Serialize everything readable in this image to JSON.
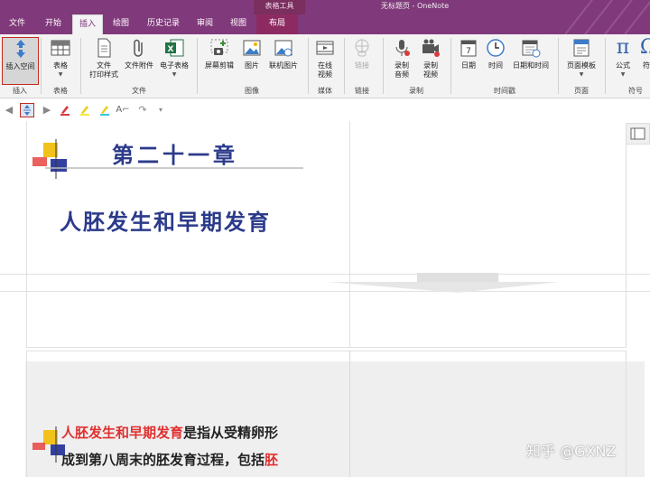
{
  "title_bar": {
    "contextual_label": "表格工具",
    "window_title": "无标题页 - OneNote"
  },
  "tabs": [
    {
      "label": "文件"
    },
    {
      "label": "开始"
    },
    {
      "label": "插入"
    },
    {
      "label": "绘图"
    },
    {
      "label": "历史记录"
    },
    {
      "label": "审阅"
    },
    {
      "label": "视图"
    },
    {
      "label": "布局"
    }
  ],
  "ribbon": {
    "insert_space": "插入空间",
    "table": "表格",
    "file_printout": "文件\n打印样式",
    "file_attachment": "文件附件",
    "spreadsheet": "电子表格",
    "screen_clipping": "屏幕剪辑",
    "picture": "图片",
    "online_picture": "联机图片",
    "online_video": "在线\n视频",
    "link": "链接",
    "record_audio": "录制\n音频",
    "record_video": "录制\n视频",
    "date": "日期",
    "time": "时间",
    "date_time": "日期和时间",
    "page_templates": "页面模板",
    "equation": "公式",
    "symbol": "符",
    "groups": {
      "insert": "插入",
      "tables": "表格",
      "files": "文件",
      "images": "图像",
      "media": "媒体",
      "links": "链接",
      "recording": "录制",
      "timestamp": "时间戳",
      "pages": "页面",
      "symbols": "符号"
    }
  },
  "page": {
    "chapter_title": "第二十一章",
    "main_title": "人胚发生和早期发育",
    "body_line1_red": "人胚发生和早期发育",
    "body_line1_rest": "是指从受精卵形",
    "body_line2_rest": "成到第八周末的胚发育过程，包括",
    "body_line2_red": "胚"
  },
  "watermark": "知乎 @GXNZ",
  "colors": {
    "title_bar": "#80397b",
    "contextual_tab": "#8e2a62",
    "ribbon_bg": "#f3f3f3",
    "heading_blue": "#2b3a8a",
    "highlight_red": "#e03030",
    "selection_border": "#c42b1c"
  }
}
